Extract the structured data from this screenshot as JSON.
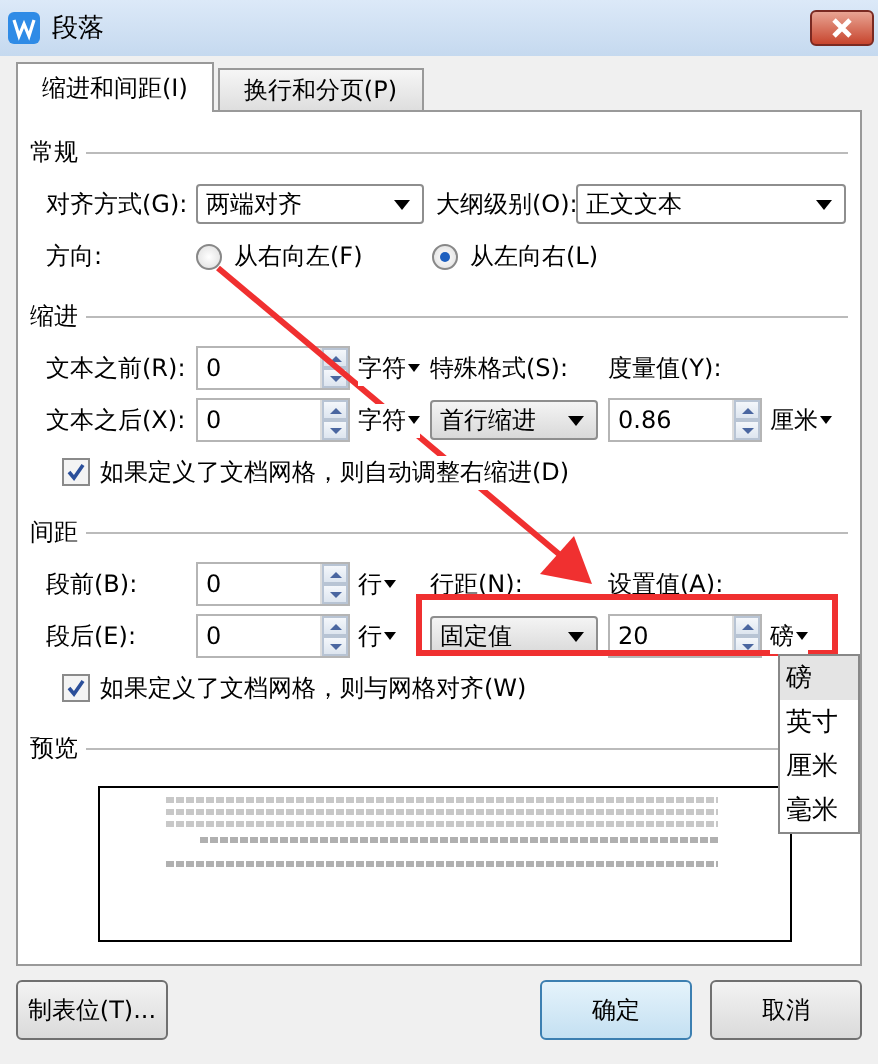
{
  "window": {
    "title": "段落"
  },
  "tabs": [
    {
      "label": "缩进和间距(I)",
      "selected": true
    },
    {
      "label": "换行和分页(P)",
      "selected": false
    }
  ],
  "general": {
    "heading": "常规",
    "alignment": {
      "label": "对齐方式(G):",
      "value": "两端对齐"
    },
    "outline_level": {
      "label": "大纲级别(O):",
      "value": "正文文本"
    },
    "direction": {
      "label": "方向:",
      "options": [
        {
          "label": "从右向左(F)",
          "selected": false
        },
        {
          "label": "从左向右(L)",
          "selected": true
        }
      ]
    }
  },
  "indent": {
    "heading": "缩进",
    "before": {
      "label": "文本之前(R):",
      "value": "0",
      "unit": "字符"
    },
    "after": {
      "label": "文本之后(X):",
      "value": "0",
      "unit": "字符"
    },
    "special": {
      "label": "特殊格式(S):",
      "value": "首行缩进"
    },
    "measure": {
      "label": "度量值(Y):",
      "value": "0.86",
      "unit": "厘米"
    },
    "grid_check": {
      "label": "如果定义了文档网格，则自动调整右缩进(D)",
      "checked": true
    }
  },
  "spacing": {
    "heading": "间距",
    "before": {
      "label": "段前(B):",
      "value": "0",
      "unit": "行"
    },
    "after": {
      "label": "段后(E):",
      "value": "0",
      "unit": "行"
    },
    "line_spacing": {
      "label": "行距(N):",
      "value": "固定值"
    },
    "setting": {
      "label": "设置值(A):",
      "value": "20",
      "unit": "磅"
    },
    "unit_menu": [
      {
        "label": "磅",
        "selected": true
      },
      {
        "label": "英寸",
        "selected": false
      },
      {
        "label": "厘米",
        "selected": false
      },
      {
        "label": "毫米",
        "selected": false
      }
    ],
    "grid_check": {
      "label": "如果定义了文档网格，则与网格对齐(W)",
      "checked": true
    }
  },
  "preview": {
    "heading": "预览"
  },
  "buttons": [
    {
      "label": "制表位(T)...",
      "kind": "secondary"
    },
    {
      "label": "确定",
      "kind": "default"
    },
    {
      "label": "取消",
      "kind": "secondary"
    }
  ]
}
